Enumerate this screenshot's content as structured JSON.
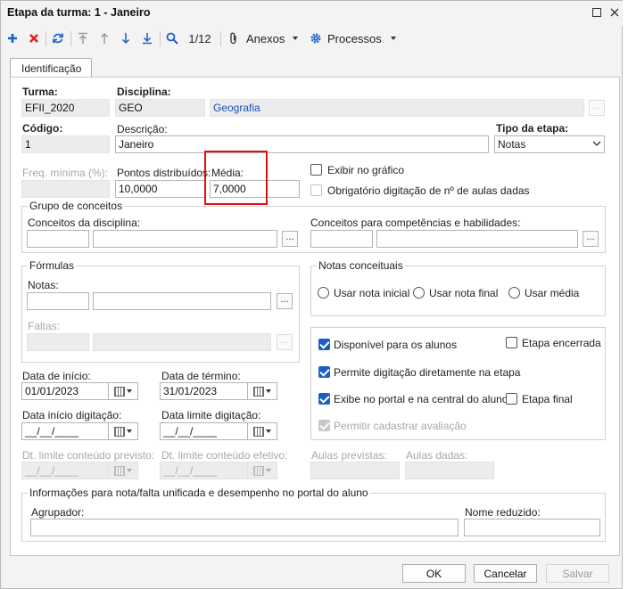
{
  "window": {
    "title": "Etapa da turma: 1 - Janeiro"
  },
  "toolbar": {
    "record_position": "1/12",
    "attachments_label": "Anexos",
    "processes_label": "Processos"
  },
  "tab": {
    "label": "Identificação"
  },
  "form": {
    "turma_label": "Turma:",
    "turma_value": "EFII_2020",
    "disciplina_label": "Disciplina:",
    "disciplina_code": "GEO",
    "disciplina_name": "Geografia",
    "codigo_label": "Código:",
    "codigo_value": "1",
    "descricao_label": "Descrição:",
    "descricao_value": "Janeiro",
    "tipo_label": "Tipo da etapa:",
    "tipo_value": "Notas",
    "freq_label": "Freq. mínima (%):",
    "freq_value": "",
    "pontos_label": "Pontos distribuídos:",
    "pontos_value": "10,0000",
    "media_label": "Média:",
    "media_value": "7,0000",
    "exibir_grafico_label": "Exibir no gráfico",
    "obrigatorio_label": "Obrigatório digitação de nº de aulas dadas"
  },
  "conceitos": {
    "group_title": "Grupo de conceitos",
    "disciplina_label": "Conceitos da disciplina:",
    "competencias_label": "Conceitos para competências e habilidades:"
  },
  "formulas": {
    "group_title": "Fórmulas",
    "notas_label": "Notas:",
    "faltas_label": "Faltas:"
  },
  "notas_conceituais": {
    "group_title": "Notas conceituais",
    "options": [
      "Usar nota inicial",
      "Usar nota final",
      "Usar média"
    ]
  },
  "options": {
    "disponivel": "Disponível para os alunos",
    "etapa_encerrada": "Etapa encerrada",
    "permite_digitacao": "Permite digitação diretamente na etapa",
    "exibe_portal": "Exibe no portal e na central do aluno",
    "etapa_final": "Etapa final",
    "permitir_avaliacao": "Permitir cadastrar avaliação"
  },
  "dates": {
    "inicio_label": "Data de início:",
    "inicio_value": "01/01/2023",
    "termino_label": "Data de término:",
    "termino_value": "31/01/2023",
    "inicio_digitacao_label": "Data início digitação:",
    "inicio_digitacao_value": "__/__/____",
    "limite_digitacao_label": "Data limite digitação:",
    "limite_digitacao_value": "__/__/____",
    "limite_previsto_label": "Dt. limite conteúdo previsto:",
    "limite_previsto_value": "__/__/____",
    "limite_efetivo_label": "Dt. limite conteúdo efetivo:",
    "limite_efetivo_value": "__/__/____"
  },
  "aulas": {
    "previstas_label": "Aulas previstas:",
    "dadas_label": "Aulas dadas:"
  },
  "unificada": {
    "group_title": "Informações para nota/falta unificada e desempenho no portal do aluno",
    "agrupador_label": "Agrupador:",
    "nome_reduzido_label": "Nome reduzido:"
  },
  "buttons": {
    "ok": "OK",
    "cancel": "Cancelar",
    "save": "Salvar"
  },
  "colors": {
    "accent": "#1a5fc8",
    "link": "#1c4fb7",
    "highlight": "#e01010"
  }
}
